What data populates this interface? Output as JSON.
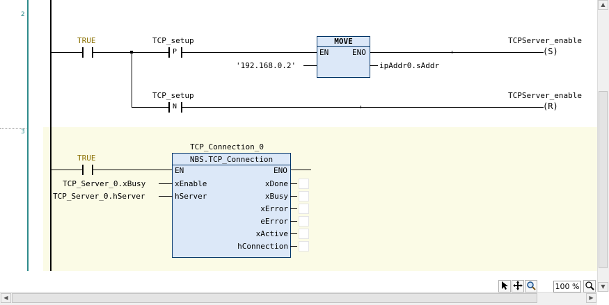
{
  "networks": {
    "n2": {
      "number": "2",
      "true_label": "TRUE",
      "contact1": {
        "name": "TCP_setup",
        "symbol": "P"
      },
      "move": {
        "title": "MOVE",
        "en": "EN",
        "eno": "ENO",
        "input": "'192.168.0.2'",
        "output": "ipAddr0.sAddr"
      },
      "coil1": {
        "name": "TCPServer_enable",
        "symbol": "S"
      },
      "contact2": {
        "name": "TCP_setup",
        "symbol": "N"
      },
      "coil2": {
        "name": "TCPServer_enable",
        "symbol": "R"
      }
    },
    "n3": {
      "number": "3",
      "true_label": "TRUE",
      "instance": "TCP_Connection_0",
      "fb_type": "NBS.TCP_Connection",
      "inputs": [
        "EN",
        "xEnable",
        "hServer"
      ],
      "input_vars": [
        "TCP_Server_0.xBusy",
        "TCP_Server_0.hServer"
      ],
      "outputs": [
        "ENO",
        "xDone",
        "xBusy",
        "xError",
        "eError",
        "xActive",
        "hConnection"
      ]
    }
  },
  "toolbar": {
    "zoom": "100 %",
    "pointer_icon": "arrow-pointer",
    "move_icon": "move-cross",
    "zoom_icon": "magnifier"
  },
  "colors": {
    "gutter_line": "#2e8b8b",
    "fb_fill": "#dce8f8",
    "net_highlight": "#fbfbe6",
    "true_text": "#8a7000"
  }
}
